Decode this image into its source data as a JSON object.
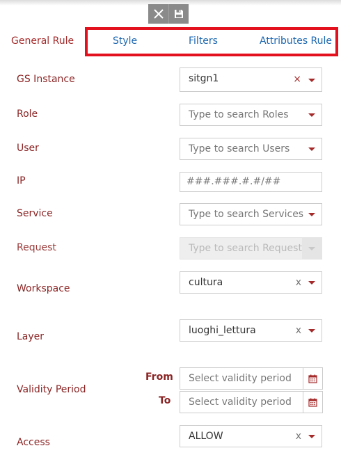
{
  "toolbar": {
    "close_icon": "close-icon",
    "save_icon": "floppy-disk-icon"
  },
  "tabs": [
    {
      "label": "General Rule",
      "active": true
    },
    {
      "label": "Style"
    },
    {
      "label": "Filters"
    },
    {
      "label": "Attributes Rule"
    }
  ],
  "form": {
    "gs_instance": {
      "label": "GS Instance",
      "value": "sitgn1",
      "clear": "×"
    },
    "role": {
      "label": "Role",
      "placeholder": "Type to search Roles"
    },
    "user": {
      "label": "User",
      "placeholder": "Type to search Users"
    },
    "ip": {
      "label": "IP",
      "placeholder": "###.###.#.#/##"
    },
    "service": {
      "label": "Service",
      "placeholder": "Type to search Services"
    },
    "request": {
      "label": "Request",
      "placeholder": "Type to search Request",
      "disabled": true
    },
    "workspace": {
      "label": "Workspace",
      "value": "cultura",
      "clear": "x"
    },
    "layer": {
      "label": "Layer",
      "value": "luoghi_lettura",
      "clear": "x"
    },
    "validity": {
      "label": "Validity Period",
      "from_label": "From",
      "to_label": "To",
      "from_placeholder": "Select validity period",
      "to_placeholder": "Select validity period",
      "calendar_icon": "calendar-icon"
    },
    "access": {
      "label": "Access",
      "value": "ALLOW",
      "clear": "x"
    }
  },
  "colors": {
    "label": "#8b2424",
    "tab_link": "#1b66b0",
    "highlight_border": "#e3101e",
    "toolbar_bg": "#8a8a8a"
  }
}
